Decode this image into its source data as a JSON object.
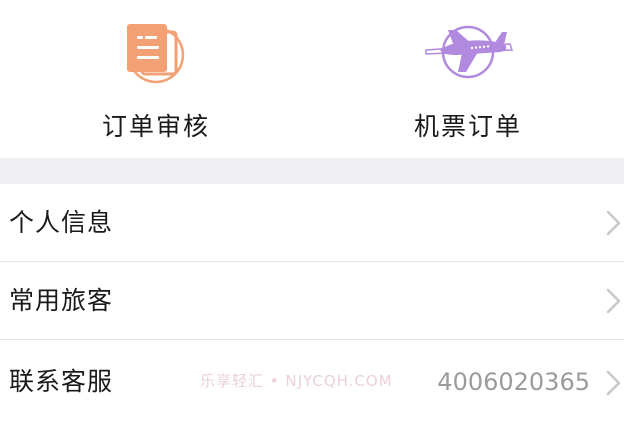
{
  "quick_actions": [
    {
      "label": "订单审核",
      "icon": "document-icon",
      "color": "#f2a074"
    },
    {
      "label": "机票订单",
      "icon": "airplane-icon",
      "color": "#b18ae0"
    }
  ],
  "menu": {
    "items": [
      {
        "label": "个人信息",
        "value": ""
      },
      {
        "label": "常用旅客",
        "value": ""
      },
      {
        "label": "联系客服",
        "value": "4006020365"
      }
    ]
  },
  "watermark": "乐享轻汇 • NJYCQH.COM"
}
